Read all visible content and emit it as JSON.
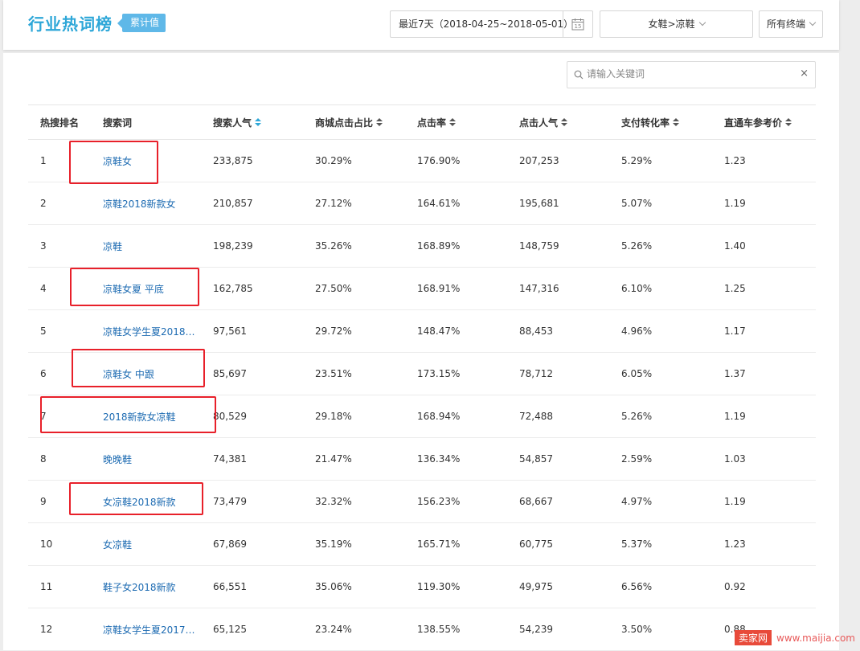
{
  "header": {
    "title": "行业热词榜",
    "badge": "累计值",
    "date_range": "最近7天（2018-04-25~2018-05-01）",
    "calendar_day": "15",
    "category": "女鞋>凉鞋",
    "terminal": "所有终端"
  },
  "search": {
    "placeholder": "请输入关键词",
    "value": "",
    "clear": "×"
  },
  "table": {
    "headers": [
      "热搜排名",
      "搜索词",
      "搜索人气",
      "商城点击占比",
      "点击率",
      "点击人气",
      "支付转化率",
      "直通车参考价"
    ],
    "active_sort": "搜索人气",
    "rows": [
      {
        "rank": "1",
        "keyword": "凉鞋女",
        "search_pop": "233,875",
        "mall_click_ratio": "30.29%",
        "ctr": "176.90%",
        "click_pop": "207,253",
        "pay_cvr": "5.29%",
        "ztc_price": "1.23"
      },
      {
        "rank": "2",
        "keyword": "凉鞋2018新款女",
        "search_pop": "210,857",
        "mall_click_ratio": "27.12%",
        "ctr": "164.61%",
        "click_pop": "195,681",
        "pay_cvr": "5.07%",
        "ztc_price": "1.19"
      },
      {
        "rank": "3",
        "keyword": "凉鞋",
        "search_pop": "198,239",
        "mall_click_ratio": "35.26%",
        "ctr": "168.89%",
        "click_pop": "148,759",
        "pay_cvr": "5.26%",
        "ztc_price": "1.40"
      },
      {
        "rank": "4",
        "keyword": "凉鞋女夏 平底",
        "search_pop": "162,785",
        "mall_click_ratio": "27.50%",
        "ctr": "168.91%",
        "click_pop": "147,316",
        "pay_cvr": "6.10%",
        "ztc_price": "1.25"
      },
      {
        "rank": "5",
        "keyword": "凉鞋女学生夏2018新...",
        "search_pop": "97,561",
        "mall_click_ratio": "29.72%",
        "ctr": "148.47%",
        "click_pop": "88,453",
        "pay_cvr": "4.96%",
        "ztc_price": "1.17"
      },
      {
        "rank": "6",
        "keyword": "凉鞋女 中跟",
        "search_pop": "85,697",
        "mall_click_ratio": "23.51%",
        "ctr": "173.15%",
        "click_pop": "78,712",
        "pay_cvr": "6.05%",
        "ztc_price": "1.37"
      },
      {
        "rank": "7",
        "keyword": "2018新款女凉鞋",
        "search_pop": "80,529",
        "mall_click_ratio": "29.18%",
        "ctr": "168.94%",
        "click_pop": "72,488",
        "pay_cvr": "5.26%",
        "ztc_price": "1.19"
      },
      {
        "rank": "8",
        "keyword": "晚晚鞋",
        "search_pop": "74,381",
        "mall_click_ratio": "21.47%",
        "ctr": "136.34%",
        "click_pop": "54,857",
        "pay_cvr": "2.59%",
        "ztc_price": "1.03"
      },
      {
        "rank": "9",
        "keyword": "女凉鞋2018新款",
        "search_pop": "73,479",
        "mall_click_ratio": "32.32%",
        "ctr": "156.23%",
        "click_pop": "68,667",
        "pay_cvr": "4.97%",
        "ztc_price": "1.19"
      },
      {
        "rank": "10",
        "keyword": "女凉鞋",
        "search_pop": "67,869",
        "mall_click_ratio": "35.19%",
        "ctr": "165.71%",
        "click_pop": "60,775",
        "pay_cvr": "5.37%",
        "ztc_price": "1.23"
      },
      {
        "rank": "11",
        "keyword": "鞋子女2018新款",
        "search_pop": "66,551",
        "mall_click_ratio": "35.06%",
        "ctr": "119.30%",
        "click_pop": "49,975",
        "pay_cvr": "6.56%",
        "ztc_price": "0.92"
      },
      {
        "rank": "12",
        "keyword": "凉鞋女学生夏2017新...",
        "search_pop": "65,125",
        "mall_click_ratio": "23.24%",
        "ctr": "138.55%",
        "click_pop": "54,239",
        "pay_cvr": "3.50%",
        "ztc_price": "0.88"
      }
    ]
  },
  "highlighted_rows": [
    "1",
    "4",
    "6",
    "7",
    "9"
  ],
  "colors": {
    "accent": "#2ea7d8",
    "keyword_link": "#1d6bb2",
    "highlight_box": "#e8202a"
  },
  "watermark": {
    "logo": "卖家网",
    "url": "www.maijia.com"
  }
}
